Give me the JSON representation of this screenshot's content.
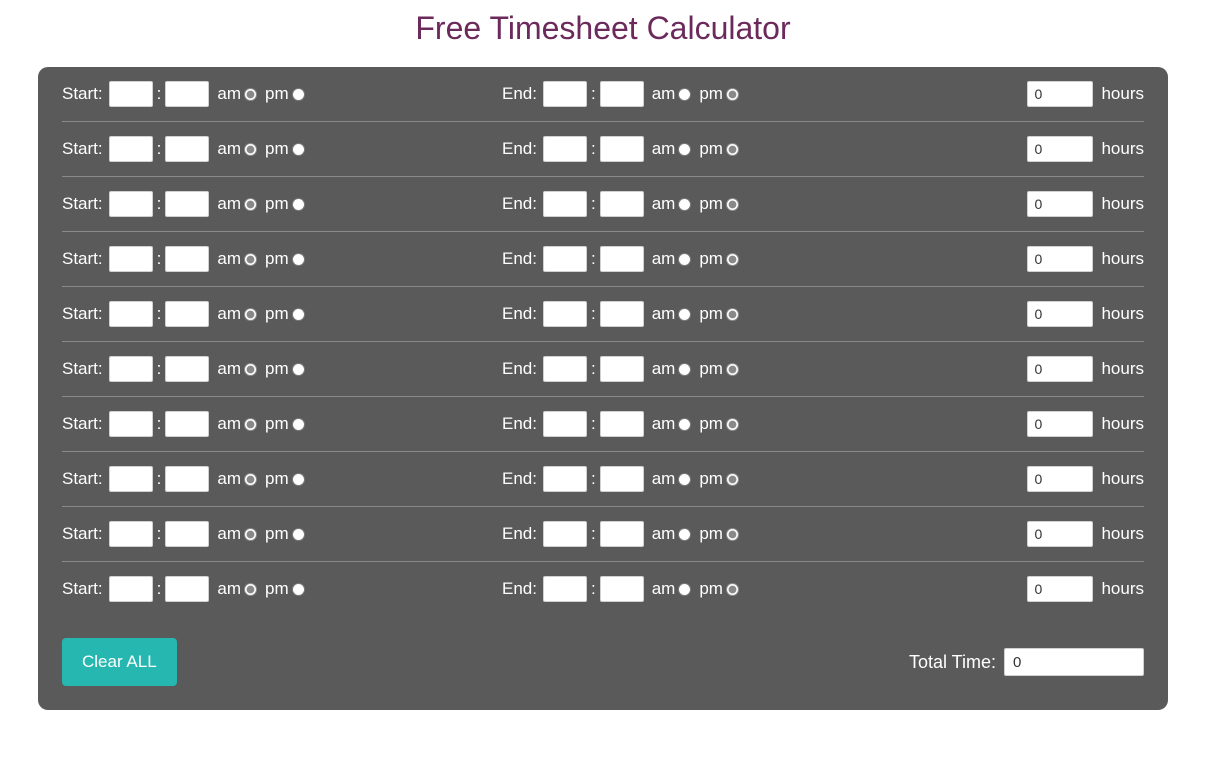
{
  "title": "Free Timesheet Calculator",
  "labels": {
    "start": "Start:",
    "end": "End:",
    "am": "am",
    "pm": "pm",
    "hours": "hours",
    "total": "Total Time:",
    "clear": "Clear ALL"
  },
  "rows": [
    {
      "start_hour": "",
      "start_min": "",
      "start_am": true,
      "end_hour": "",
      "end_min": "",
      "end_pm": true,
      "hours": "0"
    },
    {
      "start_hour": "",
      "start_min": "",
      "start_am": true,
      "end_hour": "",
      "end_min": "",
      "end_pm": true,
      "hours": "0"
    },
    {
      "start_hour": "",
      "start_min": "",
      "start_am": true,
      "end_hour": "",
      "end_min": "",
      "end_pm": true,
      "hours": "0"
    },
    {
      "start_hour": "",
      "start_min": "",
      "start_am": true,
      "end_hour": "",
      "end_min": "",
      "end_pm": true,
      "hours": "0"
    },
    {
      "start_hour": "",
      "start_min": "",
      "start_am": true,
      "end_hour": "",
      "end_min": "",
      "end_pm": true,
      "hours": "0"
    },
    {
      "start_hour": "",
      "start_min": "",
      "start_am": true,
      "end_hour": "",
      "end_min": "",
      "end_pm": true,
      "hours": "0"
    },
    {
      "start_hour": "",
      "start_min": "",
      "start_am": true,
      "end_hour": "",
      "end_min": "",
      "end_pm": true,
      "hours": "0"
    },
    {
      "start_hour": "",
      "start_min": "",
      "start_am": true,
      "end_hour": "",
      "end_min": "",
      "end_pm": true,
      "hours": "0"
    },
    {
      "start_hour": "",
      "start_min": "",
      "start_am": true,
      "end_hour": "",
      "end_min": "",
      "end_pm": true,
      "hours": "0"
    },
    {
      "start_hour": "",
      "start_min": "",
      "start_am": true,
      "end_hour": "",
      "end_min": "",
      "end_pm": true,
      "hours": "0"
    }
  ],
  "total_time": "0"
}
